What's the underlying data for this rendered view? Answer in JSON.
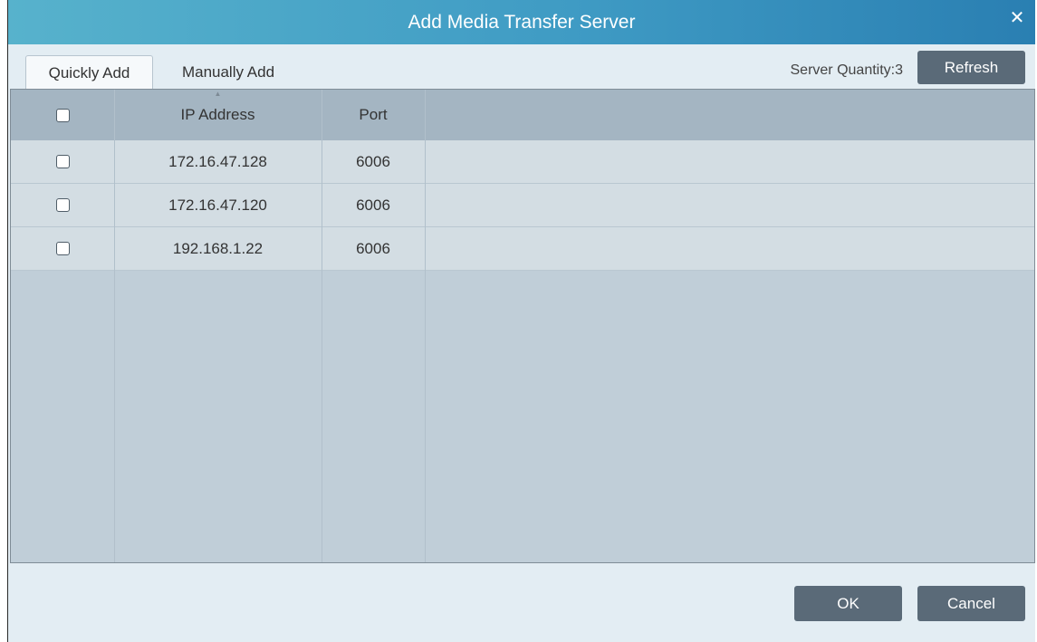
{
  "dialog": {
    "title": "Add Media Transfer Server",
    "close_icon": "close-icon",
    "close_glyph": "✕"
  },
  "tabs": [
    {
      "label": "Quickly Add",
      "active": true
    },
    {
      "label": "Manually Add",
      "active": false
    }
  ],
  "toolbar": {
    "server_quantity": "Server Quantity:3",
    "refresh_label": "Refresh"
  },
  "table": {
    "columns": [
      "",
      "IP Address",
      "Port",
      ""
    ],
    "sort_icon": "sort-asc-icon",
    "rows": [
      {
        "ip": "172.16.47.128",
        "port": "6006",
        "checked": false
      },
      {
        "ip": "172.16.47.120",
        "port": "6006",
        "checked": false
      },
      {
        "ip": "192.168.1.22",
        "port": "6006",
        "checked": false
      }
    ]
  },
  "footer": {
    "ok_label": "OK",
    "cancel_label": "Cancel"
  },
  "colors": {
    "title_gradient_start": "#57b2cc",
    "title_gradient_end": "#2a7fb2",
    "button": "#5a6a78",
    "header_row": "#a4b5c2",
    "data_row": "#d3dde3",
    "table_bg": "#c0ced8",
    "dialog_bg": "#e3edf3"
  }
}
